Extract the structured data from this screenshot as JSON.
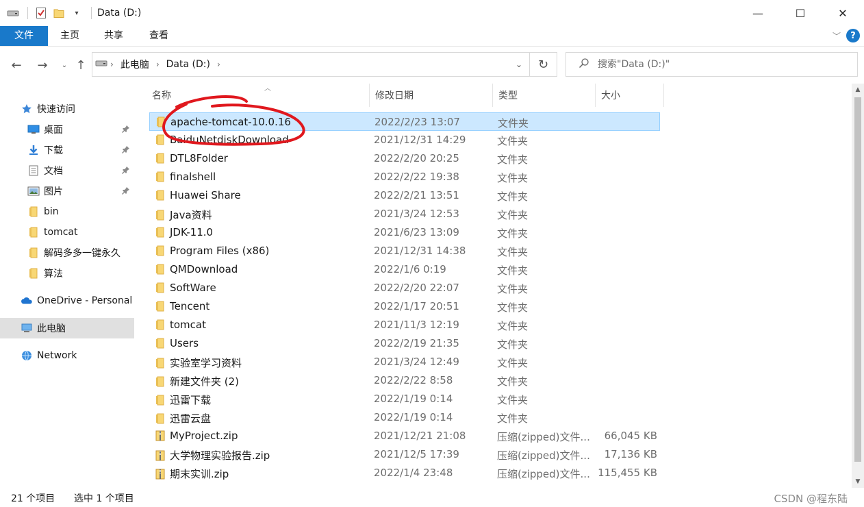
{
  "window": {
    "title": "Data (D:)",
    "minimize": "—",
    "maximize": "☐",
    "close": "✕"
  },
  "ribbon": {
    "tabs": [
      "文件",
      "主页",
      "共享",
      "查看"
    ]
  },
  "address": {
    "crumbs": [
      "此电脑",
      "Data (D:)"
    ],
    "search_placeholder": "搜索\"Data (D:)\""
  },
  "sidebar": {
    "items": [
      {
        "label": "快速访问",
        "icon": "star-icon",
        "pinned": false
      },
      {
        "label": "桌面",
        "icon": "desktop-icon",
        "pinned": true
      },
      {
        "label": "下载",
        "icon": "download-icon",
        "pinned": true
      },
      {
        "label": "文档",
        "icon": "document-icon",
        "pinned": true
      },
      {
        "label": "图片",
        "icon": "picture-icon",
        "pinned": true
      },
      {
        "label": "bin",
        "icon": "folder-icon",
        "pinned": false
      },
      {
        "label": "tomcat",
        "icon": "folder-icon",
        "pinned": false
      },
      {
        "label": "解码多多一键永久",
        "icon": "folder-icon",
        "pinned": false
      },
      {
        "label": "算法",
        "icon": "folder-icon",
        "pinned": false
      },
      {
        "label": "OneDrive - Personal",
        "icon": "onedrive-icon",
        "pinned": false
      },
      {
        "label": "此电脑",
        "icon": "this-pc-icon",
        "pinned": false
      },
      {
        "label": "Network",
        "icon": "network-icon",
        "pinned": false
      }
    ]
  },
  "columns": [
    "名称",
    "修改日期",
    "类型",
    "大小"
  ],
  "files": [
    {
      "name": "apache-tomcat-10.0.16",
      "date": "2022/2/23 13:07",
      "type": "文件夹",
      "size": "",
      "kind": "folder"
    },
    {
      "name": "BaiduNetdiskDownload",
      "date": "2021/12/31 14:29",
      "type": "文件夹",
      "size": "",
      "kind": "folder"
    },
    {
      "name": "DTL8Folder",
      "date": "2022/2/20 20:25",
      "type": "文件夹",
      "size": "",
      "kind": "folder"
    },
    {
      "name": "finalshell",
      "date": "2022/2/22 19:38",
      "type": "文件夹",
      "size": "",
      "kind": "folder"
    },
    {
      "name": "Huawei Share",
      "date": "2022/2/21 13:51",
      "type": "文件夹",
      "size": "",
      "kind": "folder"
    },
    {
      "name": "Java资料",
      "date": "2021/3/24 12:53",
      "type": "文件夹",
      "size": "",
      "kind": "folder"
    },
    {
      "name": "JDK-11.0",
      "date": "2021/6/23 13:09",
      "type": "文件夹",
      "size": "",
      "kind": "folder"
    },
    {
      "name": "Program Files (x86)",
      "date": "2021/12/31 14:38",
      "type": "文件夹",
      "size": "",
      "kind": "folder"
    },
    {
      "name": "QMDownload",
      "date": "2022/1/6 0:19",
      "type": "文件夹",
      "size": "",
      "kind": "folder"
    },
    {
      "name": "SoftWare",
      "date": "2022/2/20 22:07",
      "type": "文件夹",
      "size": "",
      "kind": "folder"
    },
    {
      "name": "Tencent",
      "date": "2022/1/17 20:51",
      "type": "文件夹",
      "size": "",
      "kind": "folder"
    },
    {
      "name": "tomcat",
      "date": "2021/11/3 12:19",
      "type": "文件夹",
      "size": "",
      "kind": "folder"
    },
    {
      "name": "Users",
      "date": "2022/2/19 21:35",
      "type": "文件夹",
      "size": "",
      "kind": "folder"
    },
    {
      "name": "实验室学习资料",
      "date": "2021/3/24 12:49",
      "type": "文件夹",
      "size": "",
      "kind": "folder"
    },
    {
      "name": "新建文件夹 (2)",
      "date": "2022/2/22 8:58",
      "type": "文件夹",
      "size": "",
      "kind": "folder"
    },
    {
      "name": "迅雷下载",
      "date": "2022/1/19 0:14",
      "type": "文件夹",
      "size": "",
      "kind": "folder"
    },
    {
      "name": "迅雷云盘",
      "date": "2022/1/19 0:14",
      "type": "文件夹",
      "size": "",
      "kind": "folder"
    },
    {
      "name": "MyProject.zip",
      "date": "2021/12/21 21:08",
      "type": "压缩(zipped)文件...",
      "size": "66,045 KB",
      "kind": "zip"
    },
    {
      "name": "大学物理实验报告.zip",
      "date": "2021/12/5 17:39",
      "type": "压缩(zipped)文件...",
      "size": "17,136 KB",
      "kind": "zip"
    },
    {
      "name": "期末实训.zip",
      "date": "2022/1/4 23:48",
      "type": "压缩(zipped)文件...",
      "size": "115,455 KB",
      "kind": "zip"
    }
  ],
  "selected_index": 0,
  "status": {
    "count": "21 个项目",
    "selected": "选中 1 个项目",
    "watermark": "CSDN @程东陆"
  },
  "colors": {
    "accent": "#1979ca",
    "selection": "#cce8ff",
    "annotation": "#e0181e",
    "folder": "#f8d775"
  }
}
